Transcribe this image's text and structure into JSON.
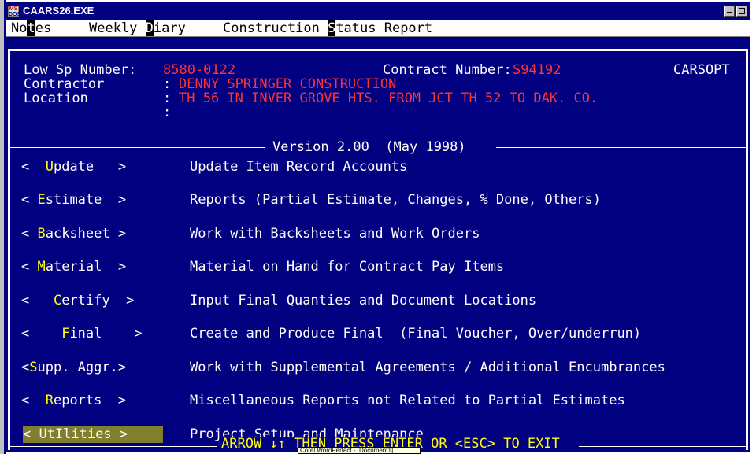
{
  "window": {
    "title": "CAARS26.EXE",
    "icon": "ms-dos-icon"
  },
  "menubar": {
    "items": [
      {
        "pre": "No",
        "hot": "t",
        "post": "es"
      },
      {
        "pre": "Weekly ",
        "hot": "D",
        "post": "iary"
      },
      {
        "pre": "Construction ",
        "hot": "S",
        "post": "tatus Report"
      }
    ]
  },
  "header": {
    "low_sp_label": "Low Sp Number:",
    "low_sp_value": "8580-0122",
    "contract_label": "Contract Number:",
    "contract_value": "S94192",
    "system_name": "CARSOPT",
    "contractor_label": "Contractor",
    "contractor_value": "DENNY SPRINGER CONSTRUCTION",
    "location_label": "Location",
    "location_value": "TH 56 IN INVER GROVE HTS. FROM JCT TH 52 TO DAK. CO.",
    "colon": ":"
  },
  "version": "Version 2.00  (May 1998)",
  "menu": [
    {
      "pre": "<  ",
      "hot": "U",
      "post": "pdate   >",
      "desc": "Update Item Record Accounts",
      "selected": false
    },
    {
      "pre": "< ",
      "hot": "E",
      "post": "stimate  >",
      "desc": "Reports (Partial Estimate, Changes, % Done, Others)",
      "selected": false
    },
    {
      "pre": "< ",
      "hot": "B",
      "post": "acksheet >",
      "desc": "Work with Backsheets and Work Orders",
      "selected": false
    },
    {
      "pre": "< ",
      "hot": "M",
      "post": "aterial  >",
      "desc": "Material on Hand for Contract Pay Items",
      "selected": false
    },
    {
      "pre": "<   ",
      "hot": "C",
      "post": "ertify  >",
      "desc": "Input Final Quanties and Document Locations",
      "selected": false
    },
    {
      "pre": "<    ",
      "hot": "F",
      "post": "inal    >",
      "desc": "Create and Produce Final  (Final Voucher, Over/underrun)",
      "selected": false
    },
    {
      "pre": "<",
      "hot": "S",
      "post": "upp. Aggr.>",
      "desc": "Work with Supplemental Agreements / Additional Encumbrances",
      "selected": false
    },
    {
      "pre": "<  ",
      "hot": "R",
      "post": "eports  >",
      "desc": "Miscellaneous Reports not Related to Partial Estimates",
      "selected": false
    },
    {
      "pre": "< UtIlities >",
      "hot": "",
      "post": "",
      "desc": "Project Setup and Maintenance",
      "selected": true
    }
  ],
  "prompt": "ARROW ↓↑ THEN PRESS ENTER OR <ESC> TO EXIT",
  "tooltip": "Corel WordPerfect - [Document1]",
  "colors": {
    "background": "#000080",
    "hotkey": "#ffff00",
    "value_text": "#ff3333",
    "selected_bg": "#7f7f2e"
  }
}
